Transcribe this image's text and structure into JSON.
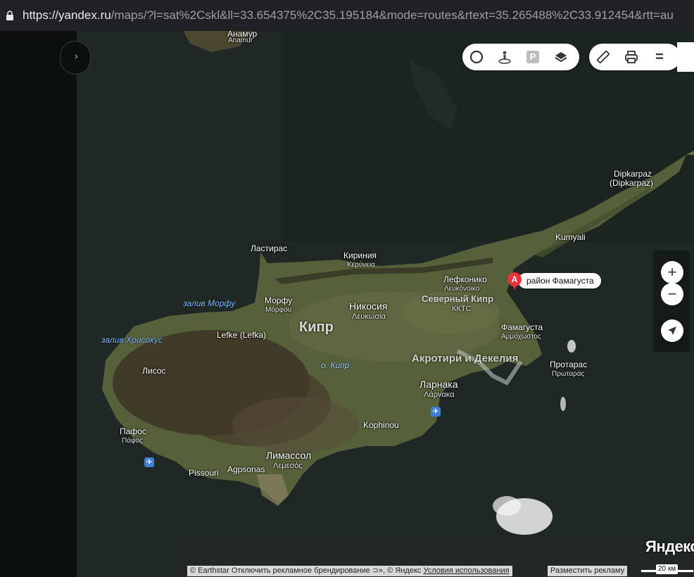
{
  "browser": {
    "url_host": "https://yandex.ru",
    "url_path": "/maps/?l=sat%2Cskl&ll=33.654375%2C35.195184&mode=routes&rtext=35.265488%2C33.912454&rtt=au"
  },
  "left_panel": {
    "button_glyph": "›"
  },
  "toolbar": {
    "group1": [
      {
        "name": "traffic-icon"
      },
      {
        "name": "panorama-icon"
      },
      {
        "name": "parking-icon",
        "text": "P"
      },
      {
        "name": "layers-icon"
      }
    ],
    "group2": [
      {
        "name": "ruler-icon"
      },
      {
        "name": "print-icon"
      },
      {
        "name": "menu-icon",
        "text": "="
      }
    ]
  },
  "zoom": {
    "plus": "+",
    "minus": "−"
  },
  "marker": {
    "letter": "A",
    "label": "район Фамагуста"
  },
  "labels": {
    "anamur": "Anamur",
    "anamur_sub": "Анамур",
    "dipkarpaz": "Dipkarpaz",
    "dipkarpaz_sub": "(Dipkarpaz)",
    "kumyali": "Kumyali",
    "lastiras": "Ластирас",
    "kirinia": "Кириния",
    "kirinia_sub": "Κερύνεια",
    "lefkoniko": "Лефконико",
    "lefkoniko_sub": "Λευκόνοικο",
    "north_cyprus": "Северный Кипр",
    "north_cyprus_sub": "ККТС",
    "morfu": "Морфу",
    "morfu_sub": "Μόρφου",
    "nicosia": "Никосия",
    "nicosia_sub": "Λευκωσία",
    "morfu_bay": "залив Морфу",
    "chrysochou_bay": "залив Хрисохус",
    "lefke": "Lefke (Lefka)",
    "cyprus": "Кипр",
    "famagusta": "Фамагуста",
    "famagusta_sub": "Αμμόχωστος",
    "akrotiri": "Акротири и Декелия",
    "protaras": "Протарас",
    "protaras_sub": "Πρωταράς",
    "island_cyprus": "о. Кипр",
    "lisos": "Лисос",
    "larnaca": "Ларнака",
    "larnaca_sub": "Λάρνακα",
    "pafos": "Пафос",
    "pafos_sub": "Πάφος",
    "kophinou": "Kophinou",
    "limassol": "Лимассол",
    "limassol_sub": "Λεμεσός",
    "pissouri": "Pissouri",
    "agrsonas": "Agpsonas"
  },
  "footer": {
    "brand": "Яндекс",
    "copyright_prefix": "© Earthstar",
    "disable_branding": "Отключить рекламное брендирование ⊃», © Яндекс",
    "terms": "Условия использования",
    "advertise": "Разместить рекламу",
    "scale": "20 км"
  },
  "colors": {
    "sea": "#1e2724",
    "land": "#4e5a34",
    "accent_red": "#e7333b"
  }
}
